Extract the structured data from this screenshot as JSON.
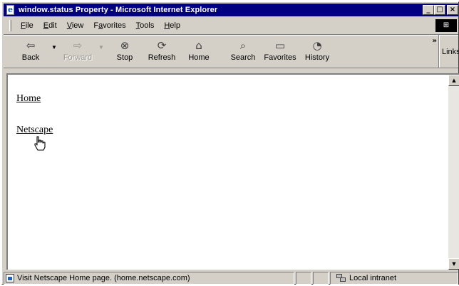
{
  "window": {
    "title": "window.status Property - Microsoft Internet Explorer"
  },
  "menu": {
    "items": [
      {
        "label": "File",
        "access": "F",
        "rest": "ile"
      },
      {
        "label": "Edit",
        "access": "E",
        "rest": "dit"
      },
      {
        "label": "View",
        "access": "V",
        "rest": "iew"
      },
      {
        "label": "Favorites",
        "pre": "F",
        "access": "a",
        "rest": "vorites"
      },
      {
        "label": "Tools",
        "access": "T",
        "rest": "ools"
      },
      {
        "label": "Help",
        "access": "H",
        "rest": "elp"
      }
    ]
  },
  "toolbar": {
    "buttons": [
      {
        "label": "Back",
        "icon": "arrow-left-icon",
        "enabled": true
      },
      {
        "label": "Forward",
        "icon": "arrow-right-icon",
        "enabled": false
      },
      {
        "label": "Stop",
        "icon": "stop-icon",
        "enabled": true
      },
      {
        "label": "Refresh",
        "icon": "refresh-icon",
        "enabled": true
      },
      {
        "label": "Home",
        "icon": "home-icon",
        "enabled": true
      },
      {
        "label": "Search",
        "icon": "search-icon",
        "enabled": true
      },
      {
        "label": "Favorites",
        "icon": "favorites-icon",
        "enabled": true
      },
      {
        "label": "History",
        "icon": "history-icon",
        "enabled": true
      }
    ],
    "chevron": "»",
    "links_label": "Links"
  },
  "content": {
    "links": [
      {
        "text": "Home"
      },
      {
        "text": "Netscape"
      }
    ]
  },
  "status": {
    "message": "Visit Netscape Home page. (home.netscape.com)",
    "zone": "Local intranet"
  },
  "colors": {
    "titlebar": "#000080",
    "chrome": "#d4d0c8",
    "page_background": "#ffffff"
  }
}
